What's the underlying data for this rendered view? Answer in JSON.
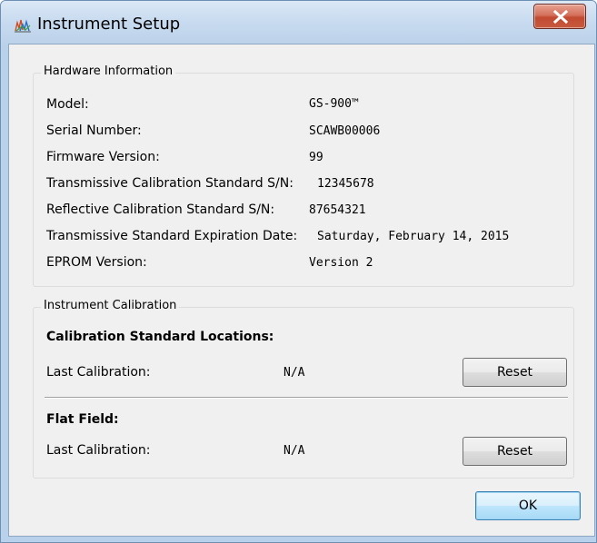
{
  "window": {
    "title": "Instrument Setup"
  },
  "hardware": {
    "group_title": "Hardware Information",
    "rows": [
      {
        "label": "Model:",
        "value": "GS-900™"
      },
      {
        "label": "Serial Number:",
        "value": "SCAWB00006"
      },
      {
        "label": "Firmware Version:",
        "value": "99"
      },
      {
        "label": "Transmissive Calibration Standard S/N:",
        "value": "12345678"
      },
      {
        "label": "Reflective Calibration Standard S/N:",
        "value": "87654321"
      },
      {
        "label": "Transmissive Standard Expiration Date:",
        "value": "Saturday, February 14, 2015"
      },
      {
        "label": "EPROM Version:",
        "value": "Version 2"
      }
    ]
  },
  "calibration": {
    "group_title": "Instrument Calibration",
    "standard_locations": {
      "heading": "Calibration Standard Locations:",
      "last_label": "Last Calibration:",
      "last_value": "N/A",
      "reset_label": "Reset"
    },
    "flat_field": {
      "heading": "Flat Field:",
      "last_label": "Last Calibration:",
      "last_value": "N/A",
      "reset_label": "Reset"
    }
  },
  "footer": {
    "ok_label": "OK"
  },
  "icons": {
    "app": "chart-icon",
    "close": "close-icon"
  },
  "colors": {
    "close_button": "#c75a3e",
    "default_button_border": "#3c7fb1",
    "dialog_background": "#f0f0f0"
  }
}
